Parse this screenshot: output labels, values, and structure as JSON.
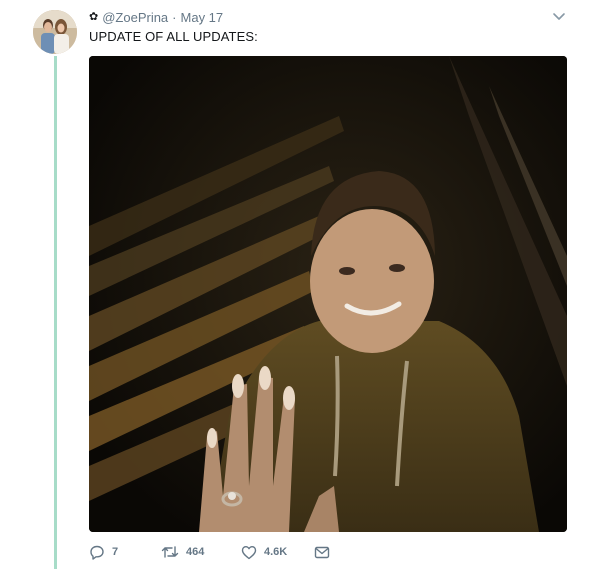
{
  "tweet": {
    "handle": "@ZoePrina",
    "separator": "·",
    "date": "May 17",
    "text": "UPDATE OF ALL UPDATES:"
  },
  "actions": {
    "replies": "7",
    "retweets": "464",
    "likes": "4.6K"
  },
  "icons": {
    "verified_like_badge": "gear-icon",
    "menu": "chevron-down-icon",
    "reply": "reply-icon",
    "retweet": "retweet-icon",
    "like": "heart-icon",
    "message": "envelope-icon"
  },
  "colors": {
    "thread_line": "#a7dcc8",
    "meta_text": "#657786",
    "primary_text": "#14171a"
  }
}
